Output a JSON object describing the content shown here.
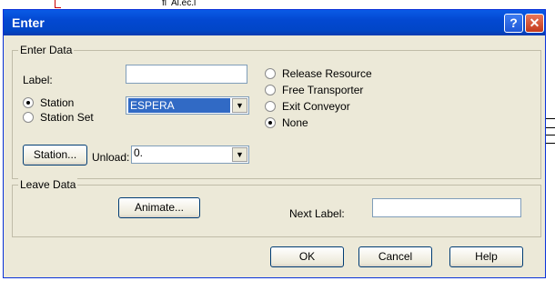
{
  "dialog": {
    "title": "Enter",
    "help_label": "?",
    "close_label": "✕"
  },
  "background": {
    "mark1": "fl",
    "mark2": "Al.ec.l"
  },
  "enter_data": {
    "legend": "Enter Data",
    "label_caption": "Label:",
    "label_value": "",
    "station_radio_label": "Station",
    "station_set_radio_label": "Station Set",
    "station_combo_value": "ESPERA",
    "station_button": "Station...",
    "unload_caption": "Unload:",
    "unload_value": "0.",
    "options": [
      {
        "label": "Release Resource",
        "selected": false
      },
      {
        "label": "Free Transporter",
        "selected": false
      },
      {
        "label": "Exit Conveyor",
        "selected": false
      },
      {
        "label": "None",
        "selected": true
      }
    ]
  },
  "leave_data": {
    "legend": "Leave Data",
    "animate_button": "Animate...",
    "next_label_caption": "Next Label:",
    "next_label_value": ""
  },
  "buttons": {
    "ok": "OK",
    "cancel": "Cancel",
    "help": "Help"
  }
}
